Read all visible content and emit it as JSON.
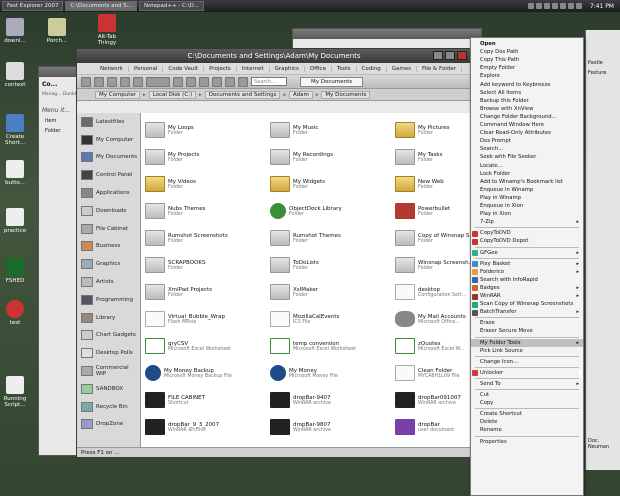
{
  "taskbar": {
    "tasks": [
      "Fast Explorer 2007",
      "C:\\Documents and S...",
      "Notepad++ - C:\\D..."
    ],
    "clock": "7:41 PM"
  },
  "desktop_icons": [
    {
      "label": "downl..."
    },
    {
      "label": "Porch..."
    },
    {
      "label": "Alt-Tab Thingy"
    },
    {
      "label": "context"
    },
    {
      "label": "Create Short..."
    },
    {
      "label": "butto..."
    },
    {
      "label": "practice"
    },
    {
      "label": "FSHED"
    },
    {
      "label": "test"
    },
    {
      "label": "Running Script..."
    }
  ],
  "background_window": {
    "title": "Co...",
    "subtitle": "Manag... Dunkt...",
    "side_items": [
      "Item",
      "Folder"
    ],
    "menu_label": "Menu it..."
  },
  "window": {
    "title": "C:\\Documents and Settings\\Adam\\My Documents",
    "menu_tabs": [
      "Network",
      "Personal",
      "Code Vault",
      "Projects",
      "Internet",
      "Graphics",
      "Office",
      "Tools",
      "Coding",
      "Games",
      "File & Folder"
    ],
    "search_placeholder": "Search...",
    "doc_tab": "My Documents",
    "breadcrumbs": [
      "My Computer",
      "Local Disk (C:)",
      "Documents and Settings",
      "Adam",
      "My Documents"
    ],
    "status": "Press F1 on ..."
  },
  "sidebar": [
    {
      "label": "Latestfiles"
    },
    {
      "label": "My Computer"
    },
    {
      "label": "My Documents"
    },
    {
      "label": "Control Panel"
    },
    {
      "label": "Applications"
    },
    {
      "label": "Downloads"
    },
    {
      "label": "File Cabinet"
    },
    {
      "label": "Business"
    },
    {
      "label": "Graphics"
    },
    {
      "label": "Artists"
    },
    {
      "label": "Programming"
    },
    {
      "label": "Library"
    },
    {
      "label": "Chart Gadgets"
    },
    {
      "label": "Desktop Polls"
    },
    {
      "label": "Commercial WIP"
    },
    {
      "label": "SANDBOX"
    },
    {
      "label": "Recycle Bin"
    },
    {
      "label": "DropZone"
    }
  ],
  "files": [
    {
      "name": "My Loops",
      "type": "Folder",
      "icon": "folder"
    },
    {
      "name": "My Music",
      "type": "Folder",
      "icon": "folder"
    },
    {
      "name": "My Pictures",
      "type": "Folder",
      "icon": "folder2"
    },
    {
      "name": "My Projects",
      "type": "Folder",
      "icon": "folder"
    },
    {
      "name": "My Recordings",
      "type": "Folder",
      "icon": "folder"
    },
    {
      "name": "My Tasks",
      "type": "Folder",
      "icon": "folder"
    },
    {
      "name": "My Videos",
      "type": "Folder",
      "icon": "folder2"
    },
    {
      "name": "My Widgets",
      "type": "Folder",
      "icon": "folder2"
    },
    {
      "name": "New Web",
      "type": "Folder",
      "icon": "folder2"
    },
    {
      "name": "Nubs Themes",
      "type": "Folder",
      "icon": "folder"
    },
    {
      "name": "ObjectDock Library",
      "type": "Folder",
      "icon": "green"
    },
    {
      "name": "Powerbullet",
      "type": "Folder",
      "icon": "red"
    },
    {
      "name": "Rumshot Screenshots",
      "type": "Folder",
      "icon": "folder"
    },
    {
      "name": "Rumshot Themes",
      "type": "Folder",
      "icon": "folder"
    },
    {
      "name": "Copy of Winsnap S...",
      "type": "Folder",
      "icon": "folder"
    },
    {
      "name": "SCRAPBOOKS",
      "type": "Folder",
      "icon": "folder"
    },
    {
      "name": "ToDoLists",
      "type": "Folder",
      "icon": "folder"
    },
    {
      "name": "Winsnap Screensh...",
      "type": "Folder",
      "icon": "folder"
    },
    {
      "name": "XmlPad Projects",
      "type": "Folder",
      "icon": "folder"
    },
    {
      "name": "XsIMaker",
      "type": "Folder",
      "icon": "folder"
    },
    {
      "name": "desktop",
      "type": "Configuration Sett...",
      "icon": "page"
    },
    {
      "name": "Virtual_Bubble_Wrap",
      "type": "Flash Movie",
      "icon": "page"
    },
    {
      "name": "MozillaCalEvents",
      "type": "ICS File",
      "icon": "page"
    },
    {
      "name": "My Mail Accounts",
      "type": "Microsoft Office...",
      "icon": "disk"
    },
    {
      "name": "qryCSV",
      "type": "Microsoft Excel Worksheet",
      "icon": "excel"
    },
    {
      "name": "temp conversion",
      "type": "Microsoft Excel Worksheet",
      "icon": "excel"
    },
    {
      "name": "zQuotes",
      "type": "Microsoft Excel W...",
      "icon": "excel"
    },
    {
      "name": "My Money Backup",
      "type": "Microsoft Money Backup File",
      "icon": "money"
    },
    {
      "name": "My Money",
      "type": "Microsoft Money File",
      "icon": "money"
    },
    {
      "name": "Clean Folder",
      "type": "MYCA8H1L09 File",
      "icon": "page"
    },
    {
      "name": "FILE CABINET",
      "type": "Shortcut",
      "icon": "dark"
    },
    {
      "name": "dropBar-9407",
      "type": "WinRAR archive",
      "icon": "dark"
    },
    {
      "name": "dropBar091007",
      "type": "WinRAR archive",
      "icon": "dark"
    },
    {
      "name": "dropBar_9_3_2007",
      "type": "WinRAR archive",
      "icon": "dark"
    },
    {
      "name": "dropBar-9807",
      "type": "WinRAR archive",
      "icon": "dark"
    },
    {
      "name": "dropBar",
      "type": "user document",
      "icon": "purple"
    }
  ],
  "context_menu": [
    {
      "label": "Open",
      "bold": true
    },
    {
      "label": "Copy Dos Path"
    },
    {
      "label": "Copy This Path"
    },
    {
      "label": "Empty Folder"
    },
    {
      "label": "Explore"
    },
    {
      "label": "Add keyword to Keybreeze"
    },
    {
      "label": "Select All Items"
    },
    {
      "label": "Backup this Folder"
    },
    {
      "label": "Browse with XnView"
    },
    {
      "label": "Change Folder Background..."
    },
    {
      "label": "Command Window Here"
    },
    {
      "label": "Clear Read-Only Attributes"
    },
    {
      "label": "Dos Prompt"
    },
    {
      "label": "Search..."
    },
    {
      "label": "Seek with File Seeker"
    },
    {
      "label": "Locate..."
    },
    {
      "label": "Lock Folder"
    },
    {
      "label": "Add to Winamp's Bookmark list"
    },
    {
      "label": "Enqueue in Winamp"
    },
    {
      "label": "Play in Winamp"
    },
    {
      "label": "Enqueue in Xion"
    },
    {
      "label": "Play in Xion"
    },
    {
      "label": "7-Zip",
      "arrow": true
    },
    {
      "sep": true
    },
    {
      "label": "CopyToDVD",
      "icon": "#c33"
    },
    {
      "label": "CopyToDVD Depot",
      "icon": "#c33"
    },
    {
      "sep": true
    },
    {
      "label": "GFGee",
      "icon": "#3a8",
      "arrow": true
    },
    {
      "sep": true
    },
    {
      "label": "Pixy Basket",
      "icon": "#48c",
      "arrow": true
    },
    {
      "label": "Folderico",
      "icon": "#e93",
      "arrow": true
    },
    {
      "label": "Search with InfoRapid",
      "icon": "#36a"
    },
    {
      "label": "Badges",
      "icon": "#c63",
      "arrow": true
    },
    {
      "label": "WinRAR",
      "icon": "#933",
      "arrow": true
    },
    {
      "label": "Scan Copy of Winsnap Screenshots",
      "icon": "#2a6"
    },
    {
      "label": "BatchTransfer",
      "icon": "#555",
      "arrow": true
    },
    {
      "sep": true
    },
    {
      "label": "Erase"
    },
    {
      "label": "Eraser Secure Move"
    },
    {
      "sep": true
    },
    {
      "label": "My Folder Tools",
      "arrow": true,
      "highlight": true
    },
    {
      "label": "Pick Link Source"
    },
    {
      "sep": true
    },
    {
      "label": "Change Icon..."
    },
    {
      "sep": true
    },
    {
      "label": "Unlocker",
      "icon": "#d33"
    },
    {
      "sep": true
    },
    {
      "label": "Send To",
      "arrow": true
    },
    {
      "sep": true
    },
    {
      "label": "Cut"
    },
    {
      "label": "Copy"
    },
    {
      "sep": true
    },
    {
      "label": "Create Shortcut"
    },
    {
      "label": "Delete"
    },
    {
      "label": "Rename"
    },
    {
      "sep": true
    },
    {
      "label": "Properties"
    }
  ],
  "right_strip": {
    "labels": [
      "Pastie",
      "Festure",
      "Doc. Neuman"
    ]
  }
}
